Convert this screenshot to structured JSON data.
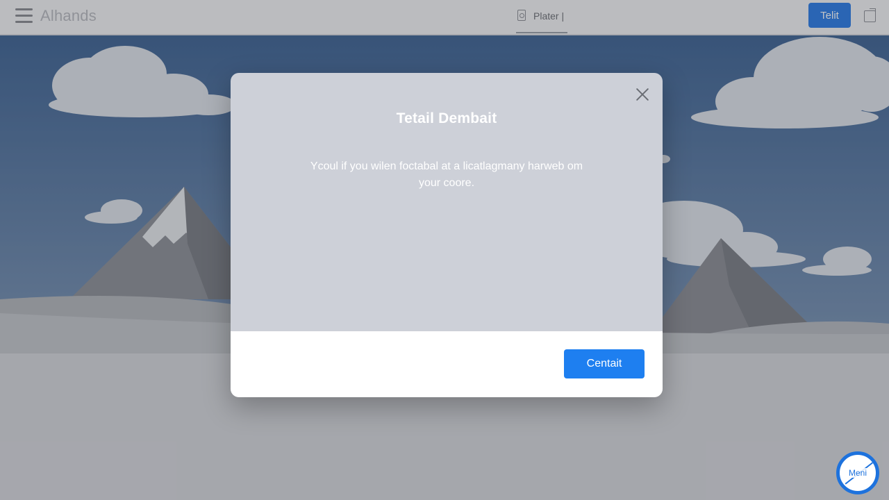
{
  "app": {
    "brand": "Alhands",
    "center_tab_label": "Plater |",
    "primary_action_label": "Telit"
  },
  "modal": {
    "title": "Tetail Dembait",
    "message": "Ycoul if you wilen foctabal at a licatlagmany harweb om your coore.",
    "confirm_label": "Centait"
  },
  "floating_button": {
    "label": "Meni"
  },
  "colors": {
    "accent": "#1e7ff0",
    "modal_body": "#cdd0d8",
    "sky": "#4f6f98"
  },
  "icons": [
    "hamburger-icon",
    "document-icon",
    "share-icon",
    "close-icon"
  ]
}
